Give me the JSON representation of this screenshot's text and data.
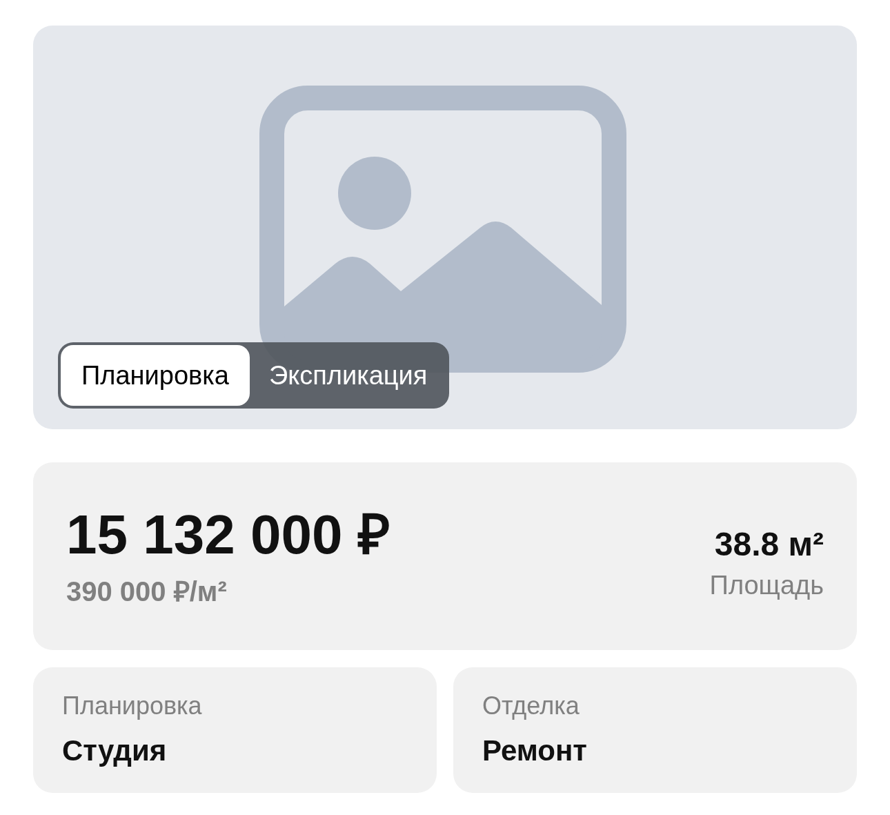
{
  "gallery": {
    "tabs": [
      {
        "label": "Планировка",
        "selected": true
      },
      {
        "label": "Экспликация",
        "selected": false
      }
    ]
  },
  "price": {
    "total": "15 132 000 ₽",
    "per_meter": "390 000 ₽/м²",
    "area": "38.8 м²",
    "area_label": "Площадь"
  },
  "details": [
    {
      "label": "Планировка",
      "value": "Студия"
    },
    {
      "label": "Отделка",
      "value": "Ремонт"
    }
  ]
}
